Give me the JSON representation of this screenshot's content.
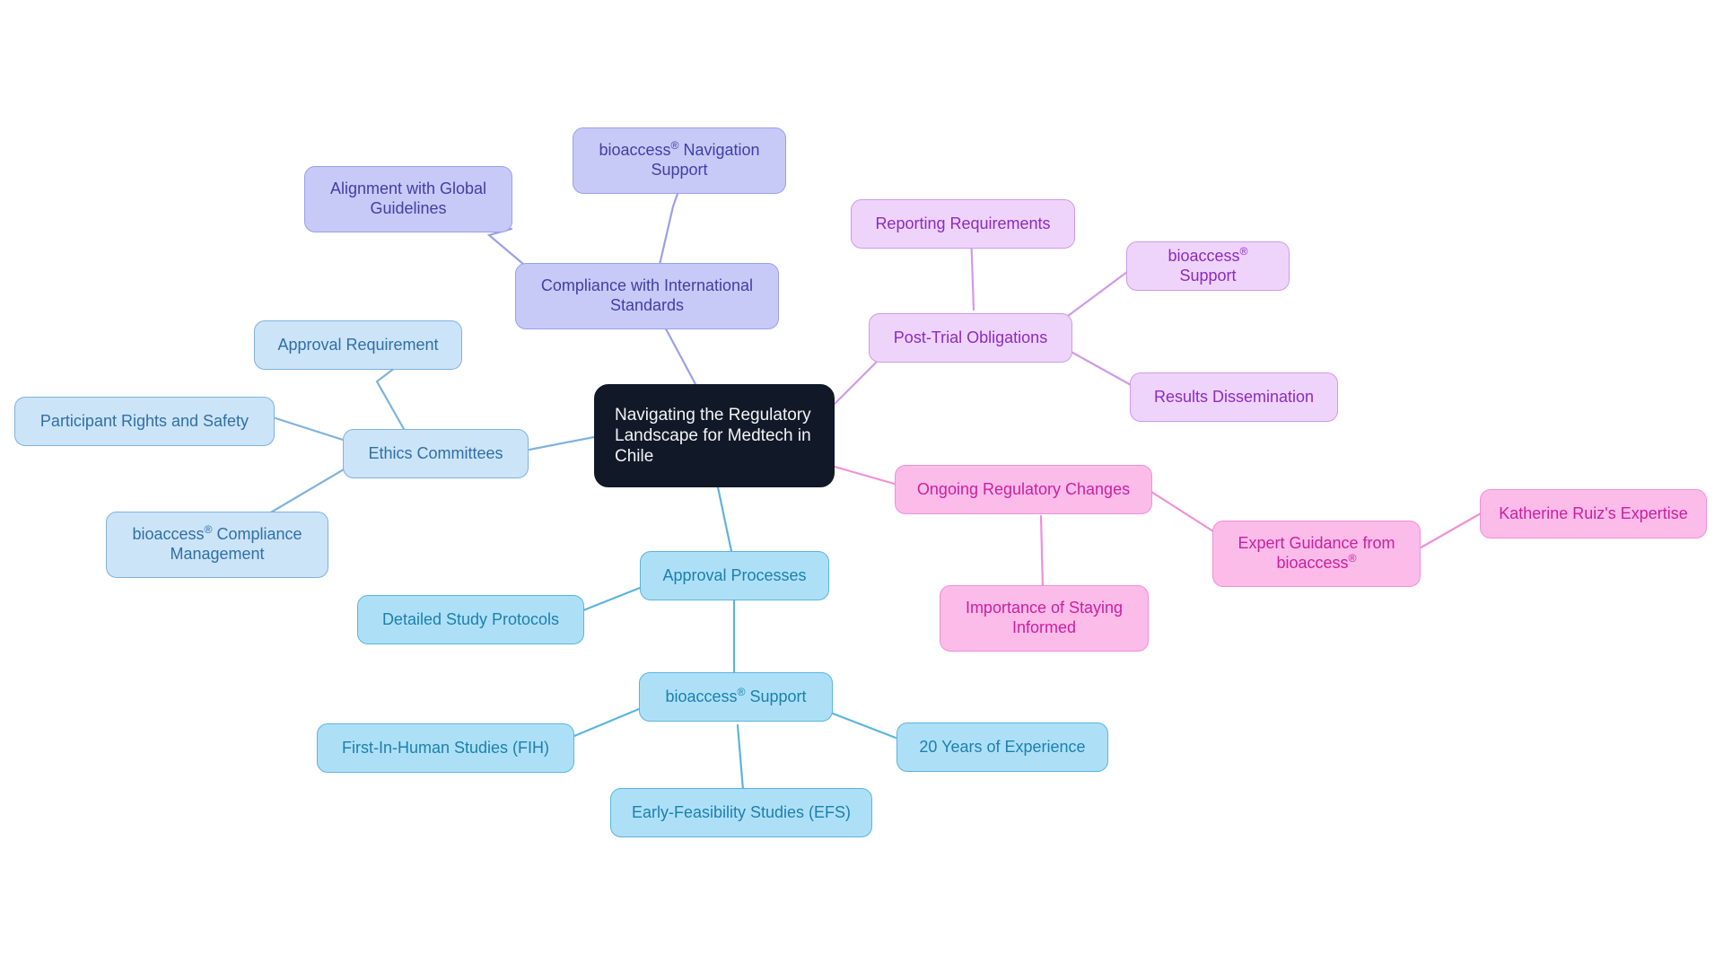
{
  "diagram": {
    "type": "mindmap",
    "title": "Navigating the Regulatory Landscape for Medtech in Chile",
    "background": "#ffffff"
  },
  "palette": {
    "root_bg": "#111827",
    "root_text": "#f3f4f6",
    "periwinkle_bg": "#c7caf6",
    "periwinkle_border": "#9aa0e8",
    "periwinkle_text": "#3f3fa8",
    "blue_bg": "#cce4f7",
    "blue_border": "#7fb2dd",
    "blue_text": "#2f6fa8",
    "sky_bg": "#ade0f7",
    "sky_border": "#5bb4dd",
    "sky_text": "#1d7fae",
    "purple_bg": "#eed4fa",
    "purple_border": "#cf9ae8",
    "purple_text": "#8d2bc4",
    "pink_bg": "#fbbce9",
    "pink_border": "#f08fd6",
    "pink_text": "#cc1f9e"
  },
  "root": {
    "label": "Navigating the Regulatory Landscape for Medtech in Chile"
  },
  "branches": [
    {
      "id": "compliance",
      "label": "Compliance with International Standards",
      "color": "periwinkle",
      "children": [
        {
          "id": "nav-support",
          "label": "bioaccess® Navigation Support"
        },
        {
          "id": "alignment",
          "label": "Alignment with Global Guidelines"
        }
      ]
    },
    {
      "id": "ethics",
      "label": "Ethics Committees",
      "color": "blue",
      "children": [
        {
          "id": "approval-req",
          "label": "Approval Requirement"
        },
        {
          "id": "participant-rights",
          "label": "Participant Rights and Safety"
        },
        {
          "id": "compliance-mgmt",
          "label": "bioaccess® Compliance Management"
        }
      ]
    },
    {
      "id": "approval-processes",
      "label": "Approval Processes",
      "color": "sky",
      "children": [
        {
          "id": "protocols",
          "label": "Detailed Study Protocols"
        },
        {
          "id": "bioaccess-support-sky",
          "label": "bioaccess® Support",
          "children": [
            {
              "id": "fih",
              "label": "First-In-Human Studies (FIH)"
            },
            {
              "id": "years",
              "label": "20 Years of Experience"
            },
            {
              "id": "efs",
              "label": "Early-Feasibility Studies (EFS)"
            }
          ]
        }
      ]
    },
    {
      "id": "post-trial",
      "label": "Post-Trial Obligations",
      "color": "purple",
      "children": [
        {
          "id": "reporting",
          "label": "Reporting Requirements"
        },
        {
          "id": "bioaccess-support-purple",
          "label": "bioaccess® Support"
        },
        {
          "id": "results",
          "label": "Results Dissemination"
        }
      ]
    },
    {
      "id": "ongoing-changes",
      "label": "Ongoing Regulatory Changes",
      "color": "pink",
      "children": [
        {
          "id": "staying-informed",
          "label": "Importance of Staying Informed"
        },
        {
          "id": "expert-guidance",
          "label": "Expert Guidance from bioaccess®",
          "children": [
            {
              "id": "katherine",
              "label": "Katherine Ruiz's Expertise"
            }
          ]
        }
      ]
    }
  ],
  "nodes": {
    "root": "Navigating the Regulatory Landscape for Medtech in Chile",
    "compliance": "Compliance with International Standards",
    "nav_support": "bioaccess® Navigation Support",
    "alignment": "Alignment with Global Guidelines",
    "ethics": "Ethics Committees",
    "approval_req": "Approval Requirement",
    "participant_rights": "Participant Rights and Safety",
    "compliance_mgmt": "bioaccess® Compliance Management",
    "approval_processes": "Approval Processes",
    "protocols": "Detailed Study Protocols",
    "bioaccess_support_sky": "bioaccess® Support",
    "fih": "First-In-Human Studies (FIH)",
    "years": "20 Years of Experience",
    "efs": "Early-Feasibility Studies (EFS)",
    "post_trial": "Post-Trial Obligations",
    "reporting": "Reporting Requirements",
    "bioaccess_support_purple": "bioaccess® Support",
    "results": "Results Dissemination",
    "ongoing_changes": "Ongoing Regulatory Changes",
    "staying_informed": "Importance of Staying Informed",
    "expert_guidance": "Expert Guidance from bioaccess®",
    "katherine": "Katherine Ruiz's Expertise"
  }
}
